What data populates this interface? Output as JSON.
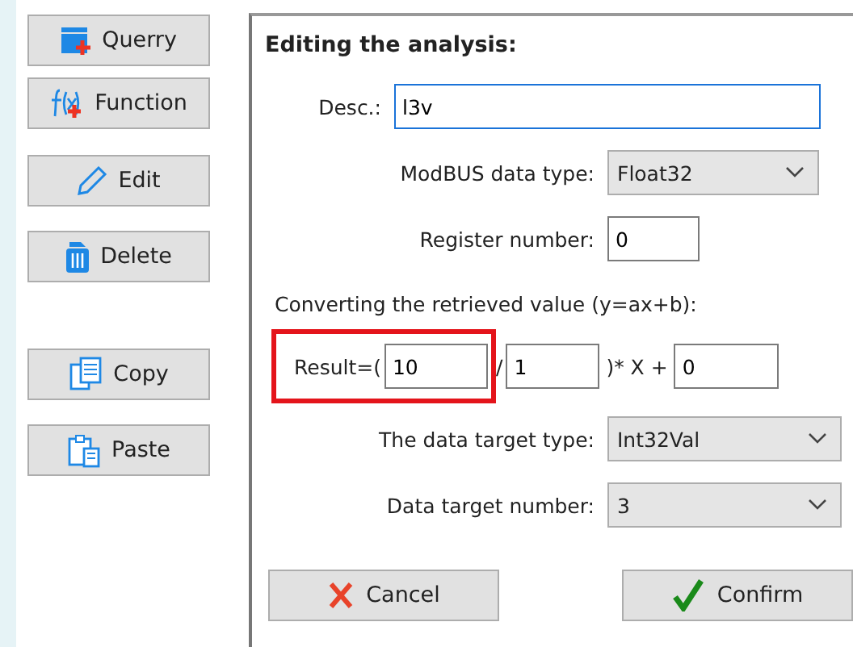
{
  "sidebar": {
    "buttons": [
      {
        "label": "Querry"
      },
      {
        "label": "Function"
      },
      {
        "label": "Edit"
      },
      {
        "label": "Delete"
      },
      {
        "label": "Copy"
      },
      {
        "label": "Paste"
      }
    ]
  },
  "panel": {
    "title": "Editing the analysis:",
    "desc": {
      "label": "Desc.:",
      "value": "l3v"
    },
    "modbus_type": {
      "label": "ModBUS data type:",
      "value": "Float32"
    },
    "register": {
      "label": "Register number:",
      "value": "0"
    },
    "converting": "Converting the retrieved value (y=ax+b):",
    "formula": {
      "prefix": "Result=(",
      "a": "10",
      "slash": "/",
      "divisor": "1",
      "mid": ")* X +",
      "b": "0",
      "highlighted": true
    },
    "target_type": {
      "label": "The data target type:",
      "value": "Int32Val"
    },
    "target_number": {
      "label": "Data target number:",
      "value": "3"
    },
    "buttons": [
      {
        "label": "Cancel",
        "kind": "cancel"
      },
      {
        "label": "Confirm",
        "kind": "confirm"
      }
    ]
  }
}
